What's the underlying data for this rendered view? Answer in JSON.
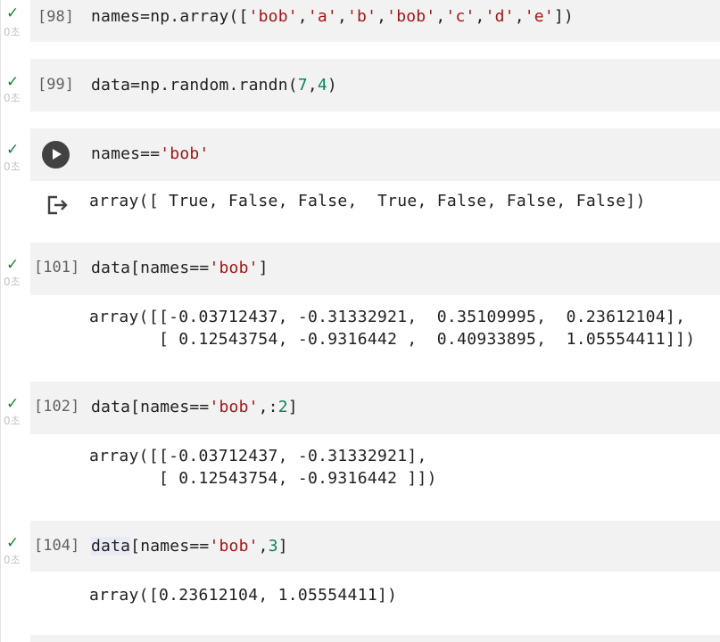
{
  "cells": [
    {
      "prompt": "[98]",
      "exec_time": "0초",
      "code": [
        {
          "t": "names=np.array(["
        },
        {
          "t": "'bob'",
          "c": "str"
        },
        {
          "t": ","
        },
        {
          "t": "'a'",
          "c": "str"
        },
        {
          "t": ","
        },
        {
          "t": "'b'",
          "c": "str"
        },
        {
          "t": ","
        },
        {
          "t": "'bob'",
          "c": "str"
        },
        {
          "t": ","
        },
        {
          "t": "'c'",
          "c": "str"
        },
        {
          "t": ","
        },
        {
          "t": "'d'",
          "c": "str"
        },
        {
          "t": ","
        },
        {
          "t": "'e'",
          "c": "str"
        },
        {
          "t": "])"
        }
      ]
    },
    {
      "prompt": "[99]",
      "exec_time": "0초",
      "code": [
        {
          "t": "data=np.random.randn("
        },
        {
          "t": "7",
          "c": "num"
        },
        {
          "t": ","
        },
        {
          "t": "4",
          "c": "num"
        },
        {
          "t": ")"
        }
      ]
    },
    {
      "prompt": "",
      "exec_time": "0초",
      "code": [
        {
          "t": "names=="
        },
        {
          "t": "'bob'",
          "c": "str"
        }
      ],
      "output": "array([ True, False, False,  True, False, False, False])"
    },
    {
      "prompt": "[101]",
      "exec_time": "0초",
      "code": [
        {
          "t": "data[names=="
        },
        {
          "t": "'bob'",
          "c": "str"
        },
        {
          "t": "]"
        }
      ],
      "output": "array([[-0.03712437, -0.31332921,  0.35109995,  0.23612104],\n       [ 0.12543754, -0.9316442 ,  0.40933895,  1.05554411]])"
    },
    {
      "prompt": "[102]",
      "exec_time": "0초",
      "code": [
        {
          "t": "data[names=="
        },
        {
          "t": "'bob'",
          "c": "str"
        },
        {
          "t": ",:"
        },
        {
          "t": "2",
          "c": "num"
        },
        {
          "t": "]"
        }
      ],
      "output": "array([[-0.03712437, -0.31332921],\n       [ 0.12543754, -0.9316442 ]])"
    },
    {
      "prompt": "[104]",
      "exec_time": "0초",
      "code": [
        {
          "t": "data",
          "c": "hl"
        },
        {
          "t": "[names=="
        },
        {
          "t": "'bob'",
          "c": "str"
        },
        {
          "t": ","
        },
        {
          "t": "3",
          "c": "num"
        },
        {
          "t": "]"
        }
      ],
      "output": "array([0.23612104, 1.05554411])"
    }
  ],
  "icons": {
    "success": "check-icon",
    "run": "play-icon",
    "output_action": "output-redirect-icon"
  },
  "colors": {
    "success_check": "#188038",
    "string": "#a31515",
    "number": "#098658",
    "cell_background": "#f2f2f2",
    "run_button": "#424242"
  }
}
